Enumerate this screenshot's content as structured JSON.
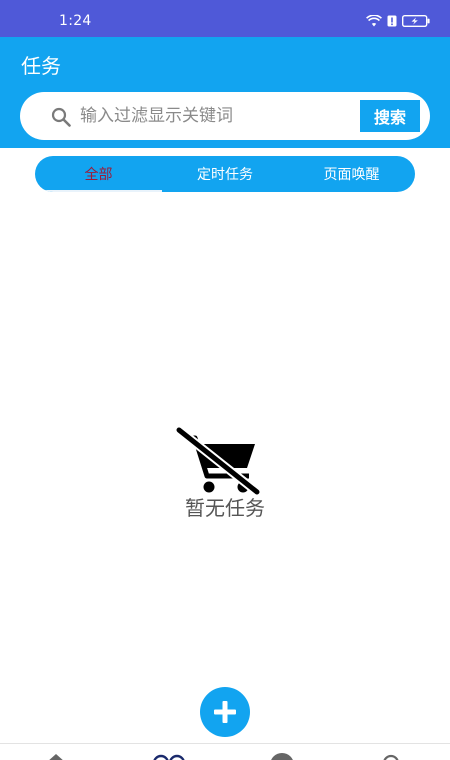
{
  "status_bar": {
    "time": "1:24"
  },
  "app": {
    "title": "任务"
  },
  "search": {
    "placeholder": "输入过滤显示关键词",
    "button_label": "搜索"
  },
  "tabs": [
    {
      "label": "全部",
      "active": true
    },
    {
      "label": "定时任务",
      "active": false
    },
    {
      "label": "页面唤醒",
      "active": false
    }
  ],
  "empty_state": {
    "message": "暂无任务",
    "icon": "remove-shopping-cart-icon"
  },
  "fab": {
    "icon": "plus-icon"
  },
  "bottom_nav": {
    "items": [
      {
        "icon": "home-icon"
      },
      {
        "icon": "tasks-icon"
      },
      {
        "icon": "circle-icon"
      },
      {
        "icon": "profile-icon"
      }
    ]
  },
  "colors": {
    "status_bar": "#4f59d8",
    "primary": "#12a4f0",
    "active_tab_text": "#9b1c3a",
    "empty_text": "#555555"
  }
}
